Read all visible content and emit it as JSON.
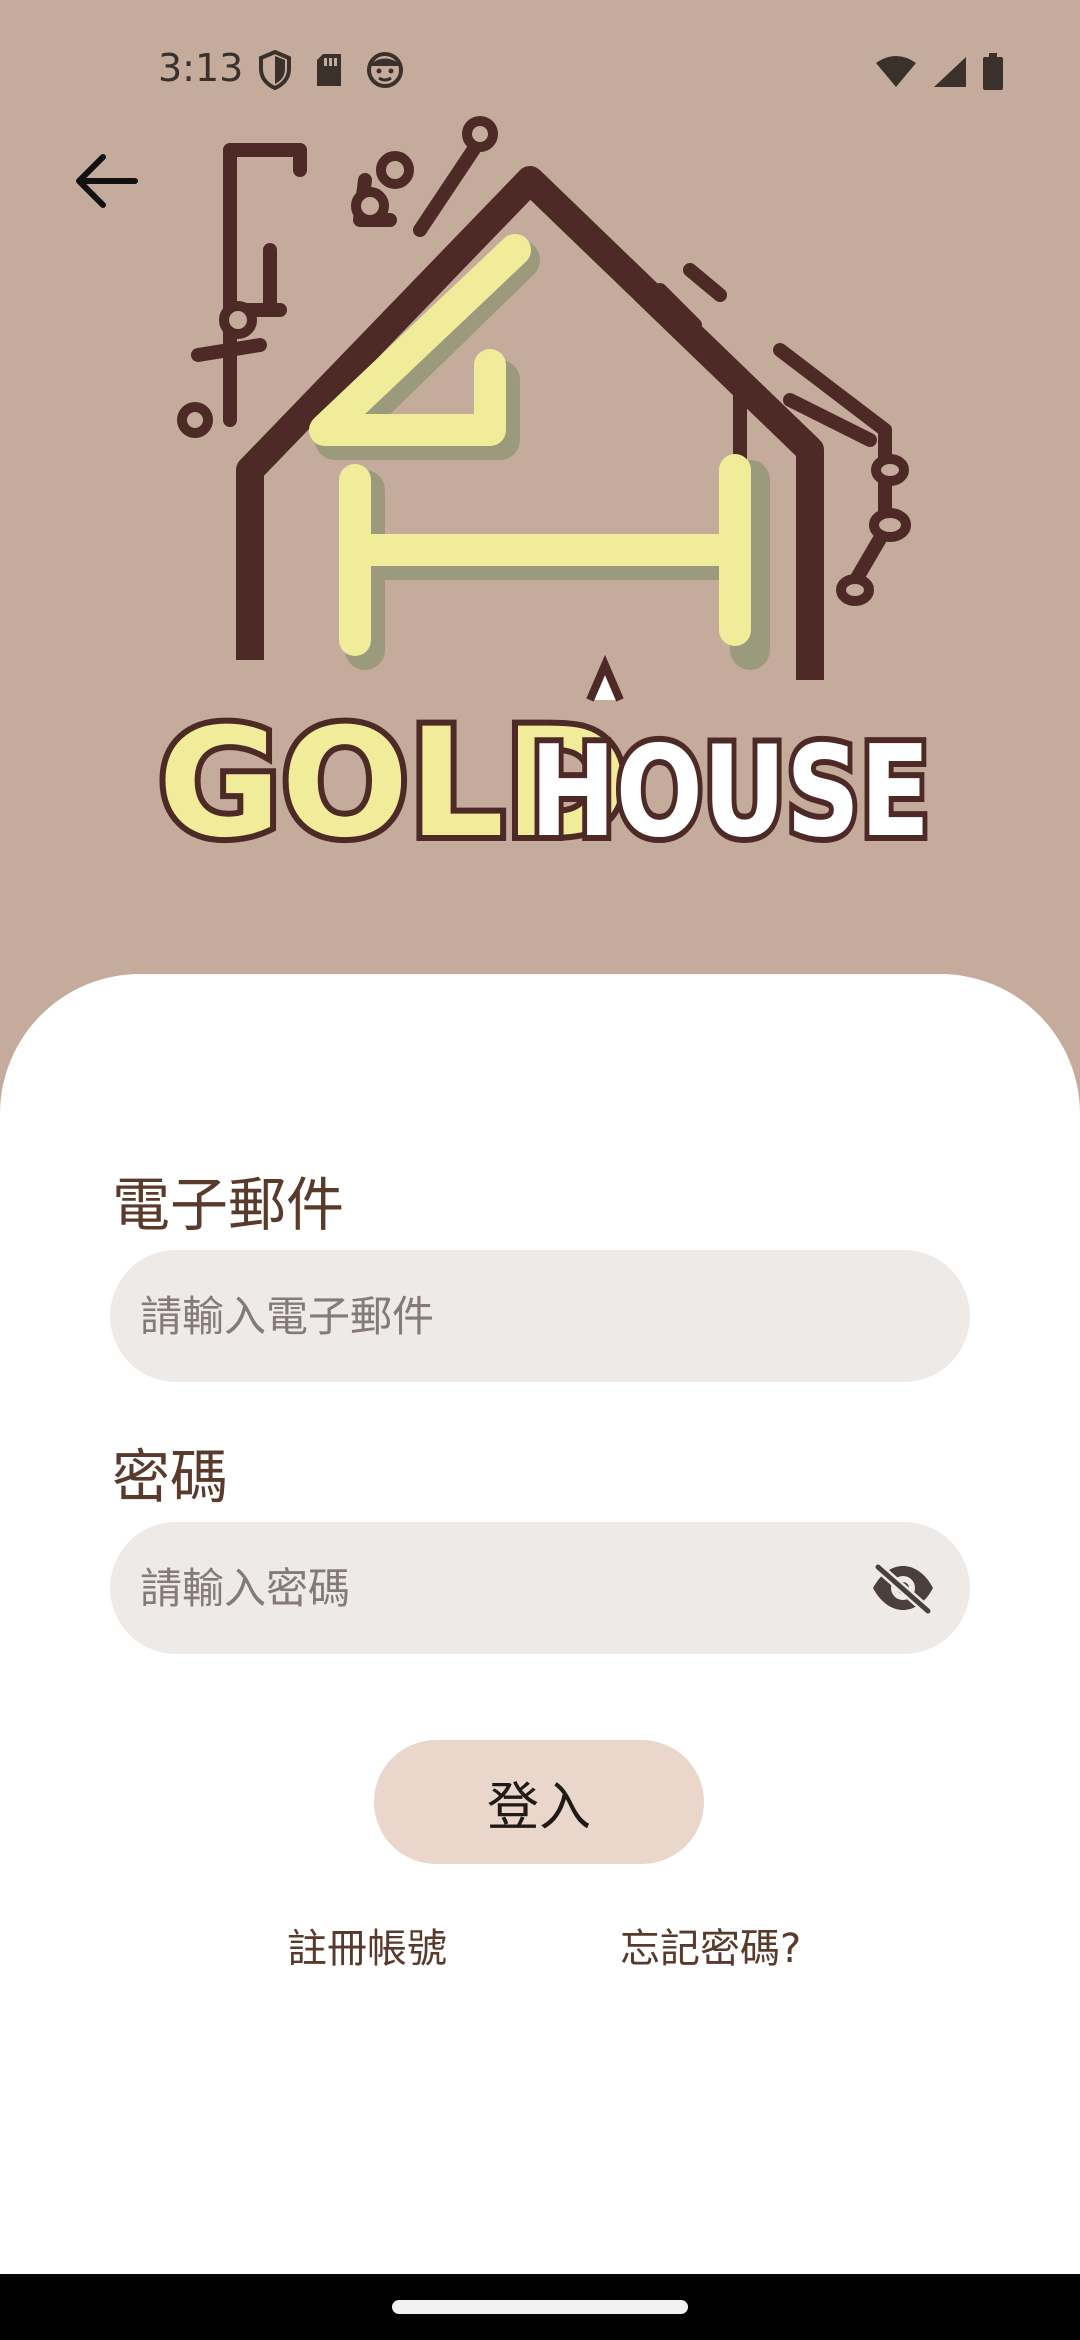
{
  "status_bar": {
    "time": "3:13",
    "left_icons": [
      "shield-icon",
      "sd-card-icon",
      "face-icon"
    ],
    "right_icons": [
      "wifi-icon",
      "signal-icon",
      "battery-icon"
    ]
  },
  "header": {
    "back_icon": "arrow-back-icon"
  },
  "logo": {
    "text": "GOLD HOUSE"
  },
  "form": {
    "email_label": "電子郵件",
    "email_placeholder": "請輸入電子郵件",
    "password_label": "密碼",
    "password_placeholder": "請輸入密碼",
    "visibility_icon": "eye-off-icon",
    "login_label": "登入",
    "register_label": "註冊帳號",
    "forgot_label": "忘記密碼?"
  },
  "colors": {
    "background": "#c5ab9c",
    "sheet": "#ffffff",
    "label_text": "#5a3a2a",
    "input_bg": "#eeeae7",
    "button_bg": "#ead6cb",
    "logo_brown": "#4e2a27",
    "logo_yellow": "#f0ec9a"
  }
}
